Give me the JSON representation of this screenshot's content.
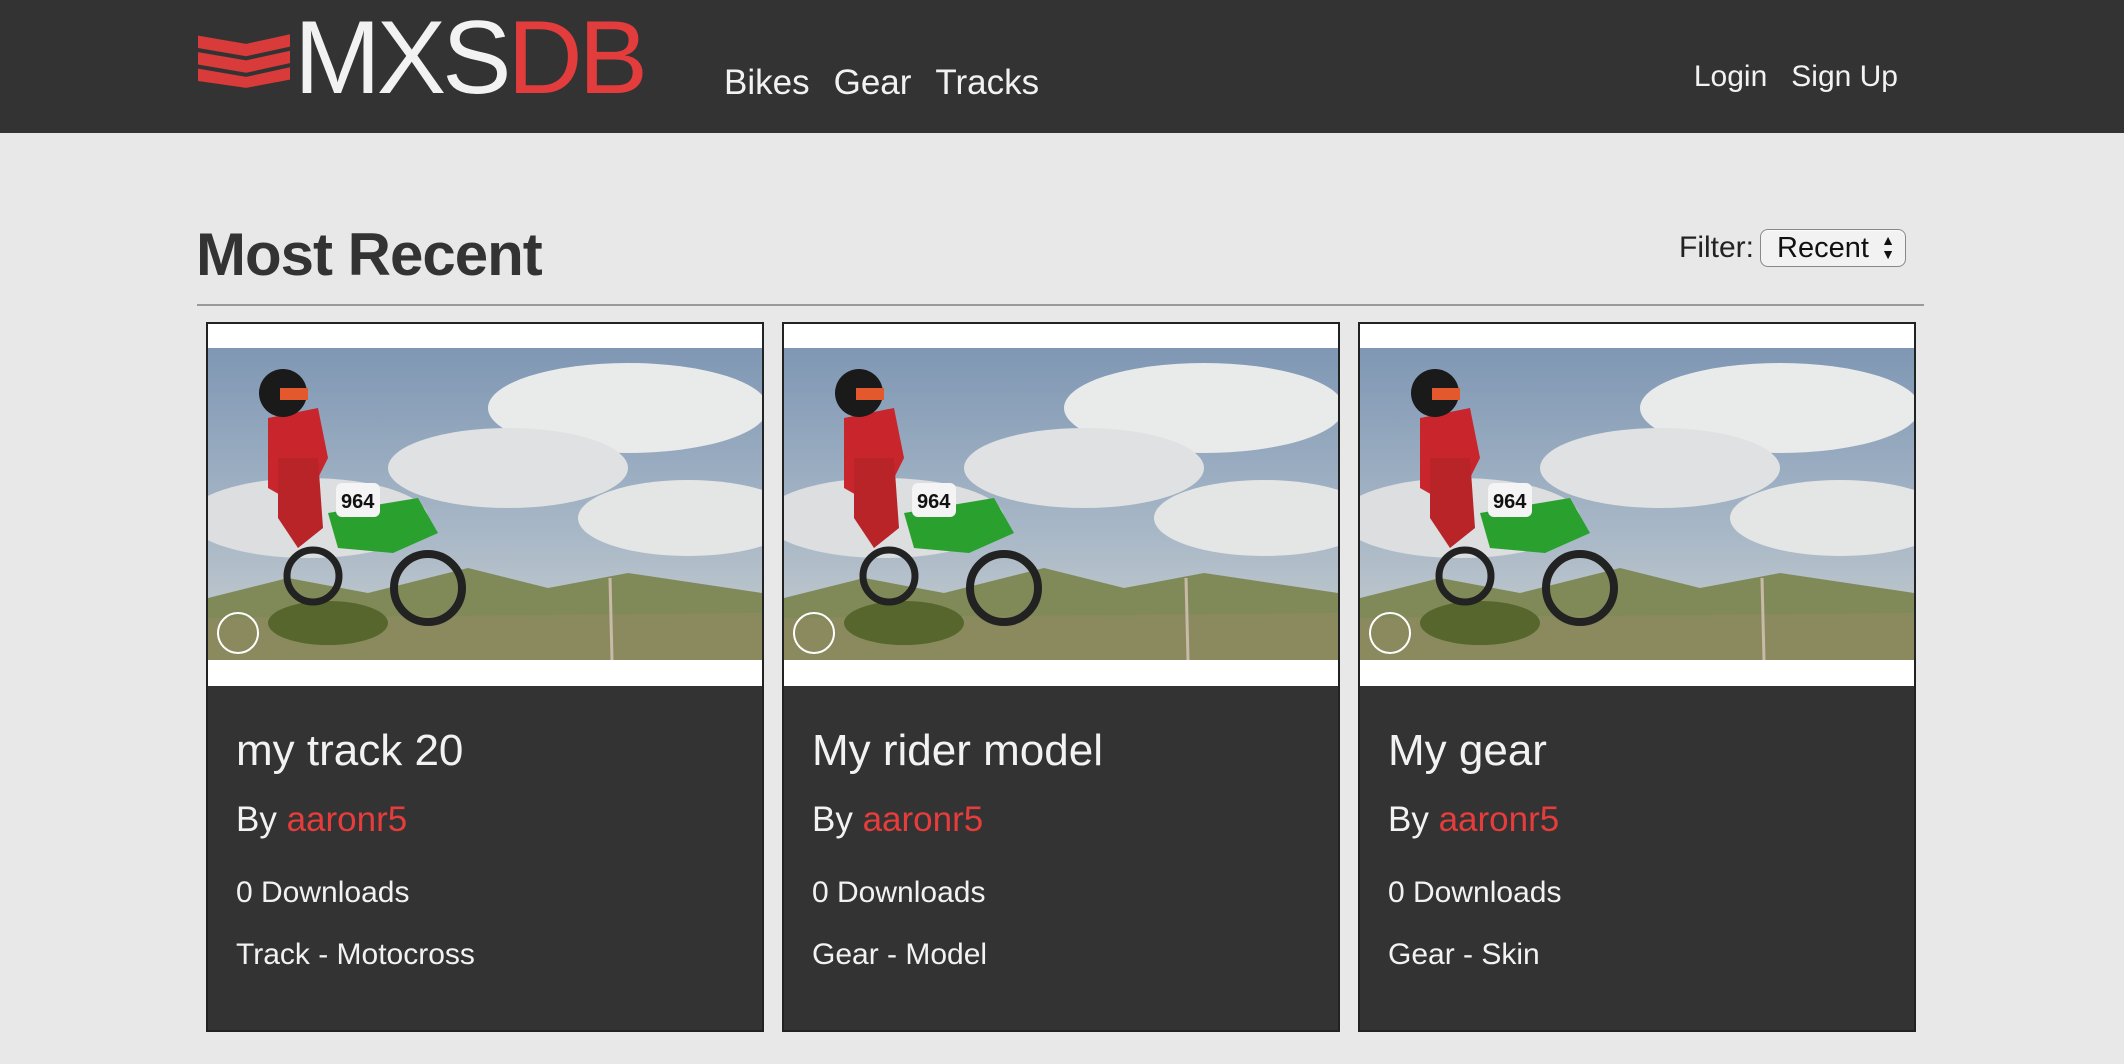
{
  "brand": {
    "logo_text_light": "MXS",
    "logo_text_accent": "DB",
    "accent_color": "#e23c3c",
    "header_color": "#333333"
  },
  "nav": {
    "items": [
      {
        "label": "Bikes"
      },
      {
        "label": "Gear"
      },
      {
        "label": "Tracks"
      }
    ]
  },
  "auth": {
    "login_label": "Login",
    "signup_label": "Sign Up"
  },
  "main": {
    "title": "Most Recent",
    "filter_label": "Filter:",
    "filter_selected": "Recent"
  },
  "cards": [
    {
      "title": "my track 20",
      "by_label": "By",
      "author": "aaronr5",
      "downloads": "0 Downloads",
      "category": "Track - Motocross"
    },
    {
      "title": "My rider model",
      "by_label": "By",
      "author": "aaronr5",
      "downloads": "0 Downloads",
      "category": "Gear - Model"
    },
    {
      "title": "My gear",
      "by_label": "By",
      "author": "aaronr5",
      "downloads": "0 Downloads",
      "category": "Gear - Skin"
    }
  ]
}
